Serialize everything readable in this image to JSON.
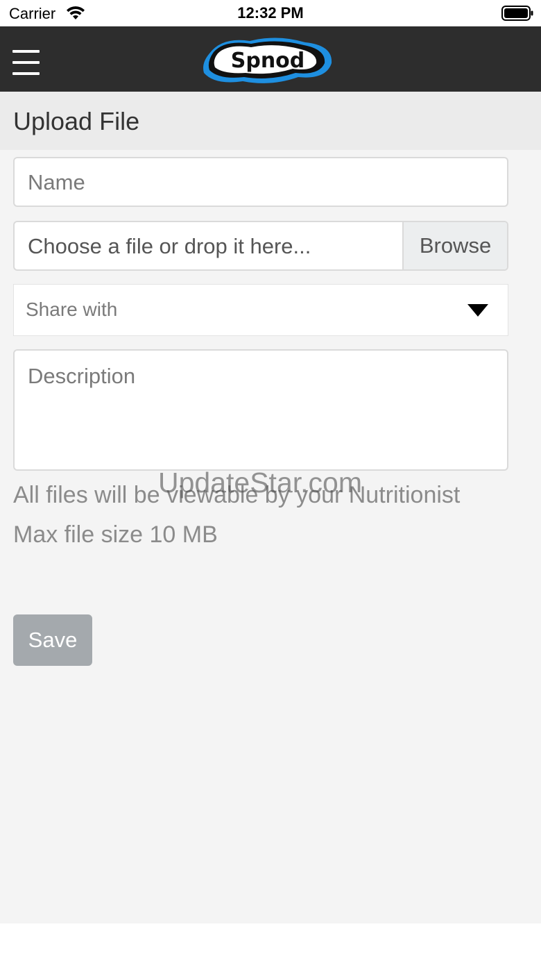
{
  "status_bar": {
    "carrier": "Carrier",
    "time": "12:32 PM"
  },
  "header": {
    "logo_text": "Spnod",
    "menu_icon": "hamburger-menu-icon"
  },
  "page": {
    "title": "Upload File"
  },
  "form": {
    "name_placeholder": "Name",
    "file_placeholder": "Choose a file or drop it here...",
    "browse_label": "Browse",
    "share_placeholder": "Share with",
    "description_placeholder": "Description",
    "info_line_1": "All files will be viewable by your Nutritionist",
    "info_line_2": "Max file size 10 MB",
    "save_label": "Save"
  },
  "watermark": "UpdateStar.com",
  "colors": {
    "header_bg": "#2d2d2d",
    "page_bg": "#f4f4f4",
    "save_button": "#a4a9ad",
    "logo_accent": "#1e8fe0"
  }
}
